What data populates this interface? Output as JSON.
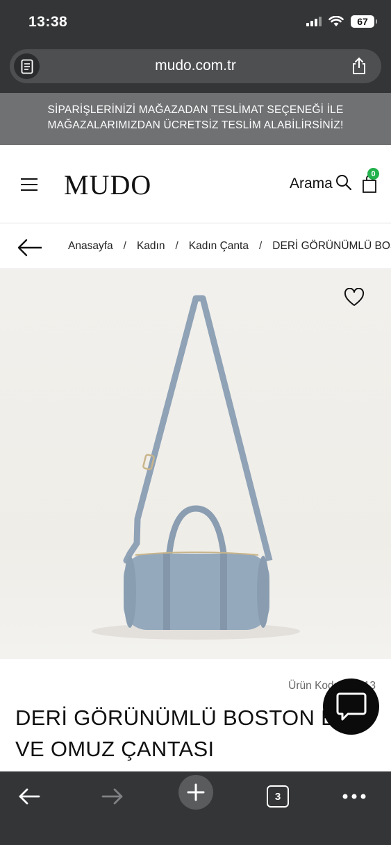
{
  "status_bar": {
    "time": "13:38",
    "battery": "67"
  },
  "browser": {
    "url": "mudo.com.tr",
    "tab_count": "3"
  },
  "promo": {
    "line1": "SİPARİŞLERİNİZİ MAĞAZADAN TESLİMAT SEÇENEĞİ İLE",
    "line2": "MAĞAZALARIMIZDAN ÜCRETSİZ TESLİM ALABİLİRSİNİZ!"
  },
  "header": {
    "logo": "MUDO",
    "search_label": "Arama",
    "cart_count": "0"
  },
  "breadcrumb": {
    "items": [
      "Anasayfa",
      "Kadın",
      "Kadın Çanta",
      "DERİ GÖRÜNÜMLÜ BOSTON EL VE OMUZ ÇANTASI"
    ],
    "separator": "/"
  },
  "product": {
    "code_label": "Ürün Kodu: 12413",
    "title_line1": "DERİ GÖRÜNÜMLÜ BOSTON EL",
    "title_line2": "VE OMUZ ÇANTASI",
    "image_alt": "Mavi deri görünümlü boston çanta",
    "bag_color": "#95a9bd"
  },
  "colors": {
    "chrome": "#343536",
    "promo_bg": "#707172",
    "badge": "#22b14c"
  },
  "icons": {
    "menu": "hamburger-icon",
    "search": "search-icon",
    "cart": "shopping-bag-icon",
    "back": "arrow-left-icon",
    "favorite": "heart-icon",
    "chat": "chat-bubble-icon",
    "share": "share-icon",
    "reader": "reader-icon"
  }
}
